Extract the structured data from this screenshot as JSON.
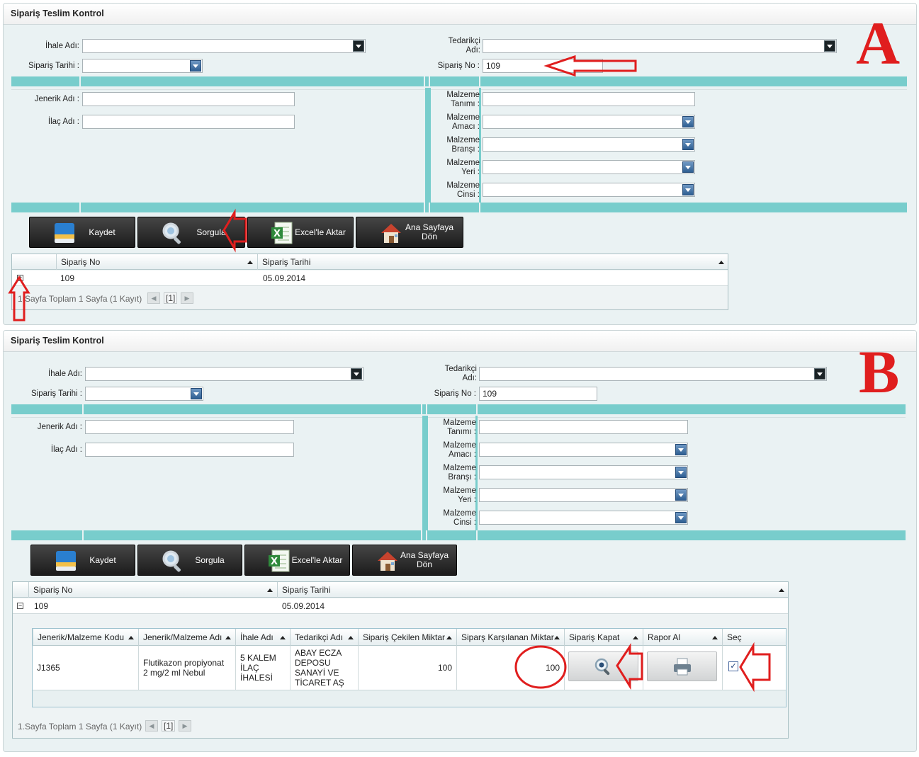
{
  "panels": {
    "A": {
      "letter": "A",
      "title": "Sipariş Teslim Kontrol",
      "ihale_label": "İhale Adı:",
      "tarih_label": "Sipariş Tarihi :",
      "tedarikci_label_1": "Tedarikçi",
      "tedarikci_label_2": "Adı:",
      "sipno_label": "Sipariş No :",
      "sipno_value": "109",
      "jenerik_label": "Jenerik Adı :",
      "ilac_label": "İlaç Adı :",
      "malzeme_word": "Malzeme",
      "tanimi": "Tanımı :",
      "amaci": "Amacı :",
      "bransi": "Branşı :",
      "yeri": "Yeri :",
      "cinsi": "Cinsi :"
    },
    "B": {
      "letter": "B",
      "title": "Sipariş Teslim Kontrol",
      "ihale_label": "İhale Adı:",
      "tarih_label": "Sipariş Tarihi :",
      "tedarikci_label_1": "Tedarikçi",
      "tedarikci_label_2": "Adı:",
      "sipno_label": "Sipariş No :",
      "sipno_value": "109",
      "jenerik_label": "Jenerik Adı :",
      "ilac_label": "İlaç Adı :",
      "malzeme_word": "Malzeme",
      "tanimi": "Tanımı :",
      "amaci": "Amacı :",
      "bransi": "Branşı :",
      "yeri": "Yeri :",
      "cinsi": "Cinsi :"
    }
  },
  "toolbar": {
    "save": "Kaydet",
    "query": "Sorgula",
    "excel": "Excel'le Aktar",
    "home_1": "Ana Sayfaya",
    "home_2": "Dön"
  },
  "grid": {
    "col_no": "Sipariş No",
    "col_date": "Sipariş Tarihi",
    "row_no": "109",
    "row_date": "05.09.2014",
    "expand_closed": "+",
    "expand_open": "−",
    "page": "1",
    "pager_a": "1.Sayfa Toplam 1 Sayfa (1 Kayıt)",
    "pager_b": "1.Sayfa Toplam 1 Sayfa (1 Kayıt)"
  },
  "subgrid": {
    "headers": [
      "Jenerik/Malzeme Kodu",
      "Jenerik/Malzeme Adı",
      "İhale Adı",
      "Tedarikçi Adı",
      "Sipariş Çekilen Miktar",
      "Siparş Karşılanan Miktar",
      "Sipariş Kapat",
      "Rapor Al",
      "Seç"
    ],
    "row": {
      "kod": "J1365",
      "ad": "Flutikazon propiyonat 2 mg/2 ml Nebul",
      "ihale": "5 KALEM İLAÇ İHALESİ",
      "tedarikci": "ABAY ECZA DEPOSU SANAYİ VE TİCARET AŞ",
      "cekilen": "100",
      "karsilanan": "100",
      "sec": "✓"
    }
  },
  "colors": {
    "teal_bar": "#78cdcc",
    "annotation_red": "#e01e1e",
    "button_dark": "#1b1b1b",
    "panel_bg": "#eaf2f3"
  },
  "icons": {
    "save": "save-disk-icon",
    "query": "magnifier-icon",
    "excel": "excel-icon",
    "home": "house-icon",
    "print": "printer-icon"
  }
}
